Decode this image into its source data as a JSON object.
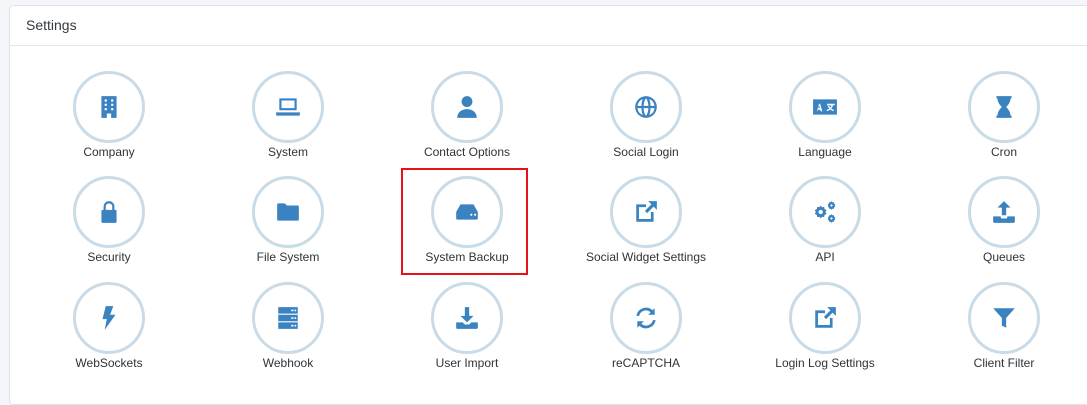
{
  "header": {
    "title": "Settings"
  },
  "tiles": [
    {
      "label": "Company",
      "icon": "building-icon"
    },
    {
      "label": "System",
      "icon": "laptop-icon"
    },
    {
      "label": "Contact Options",
      "icon": "user-icon"
    },
    {
      "label": "Social Login",
      "icon": "globe-icon"
    },
    {
      "label": "Language",
      "icon": "language-icon"
    },
    {
      "label": "Cron",
      "icon": "hourglass-icon"
    },
    {
      "label": "Security",
      "icon": "lock-icon"
    },
    {
      "label": "File System",
      "icon": "folder-icon"
    },
    {
      "label": "System Backup",
      "icon": "hard-drive-icon"
    },
    {
      "label": "Social Widget Settings",
      "icon": "external-edit-icon"
    },
    {
      "label": "API",
      "icon": "cogs-icon"
    },
    {
      "label": "Queues",
      "icon": "upload-icon"
    },
    {
      "label": "WebSockets",
      "icon": "bolt-icon"
    },
    {
      "label": "Webhook",
      "icon": "server-icon"
    },
    {
      "label": "User Import",
      "icon": "download-icon"
    },
    {
      "label": "reCAPTCHA",
      "icon": "refresh-icon"
    },
    {
      "label": "Login Log Settings",
      "icon": "external-edit-icon"
    },
    {
      "label": "Client Filter",
      "icon": "filter-icon"
    }
  ],
  "colors": {
    "icon": "#3a82c0",
    "ring": "#c9dbe7",
    "highlight": "#e8111b"
  }
}
